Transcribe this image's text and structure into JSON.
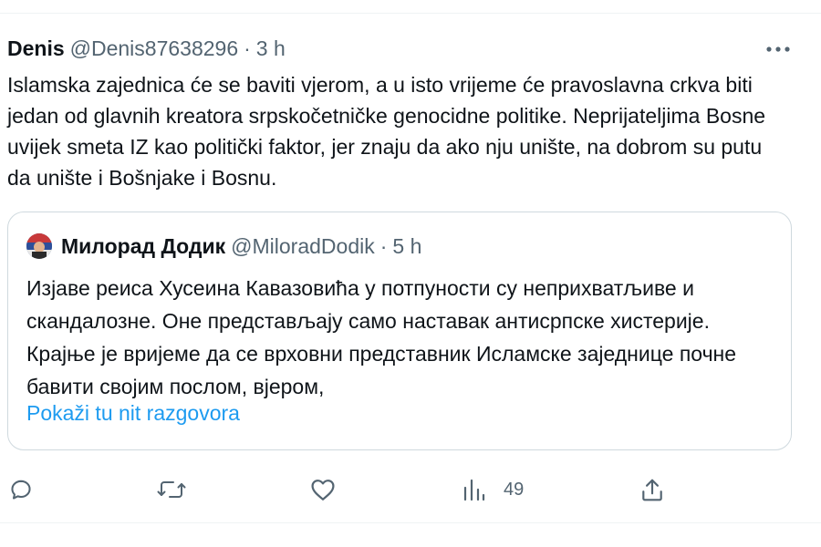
{
  "tweet": {
    "author_name": "Denis",
    "author_handle": "@Denis87638296",
    "separator": "·",
    "time": "3 h",
    "body": "Islamska zajednica će se baviti vjerom, a u isto vrijeme će pravoslavna crkva biti jedan od glavnih kreatora srpskočetničke genocidne politike. Neprijateljima Bosne uvijek smeta IZ kao politički faktor, jer znaju da ako nju unište, na dobrom su putu da unište i Bošnjake i Bosnu."
  },
  "quoted": {
    "author_name": "Милорад Додик",
    "author_handle": "@MiloradDodik",
    "separator": "·",
    "time": "5 h",
    "body": "Изјаве реиса Хусеина Кавазовића у потпуности су неприхватљиве и скандалозне. Оне представљају само наставак антисрпске хистерије. Крајње је вријеме да се врховни представник Исламске заједнице почне бавити својим послом, вјером,",
    "show_thread": "Pokaži tu nit razgovora"
  },
  "actions": {
    "views": "49"
  },
  "icons": {
    "more": "more-horizontal-icon",
    "reply": "reply-icon",
    "retweet": "retweet-icon",
    "like": "heart-icon",
    "views": "analytics-icon",
    "share": "share-icon"
  },
  "colors": {
    "text": "#0f1419",
    "secondary": "#536471",
    "link": "#1d9bf0",
    "border": "#cfd9de"
  }
}
